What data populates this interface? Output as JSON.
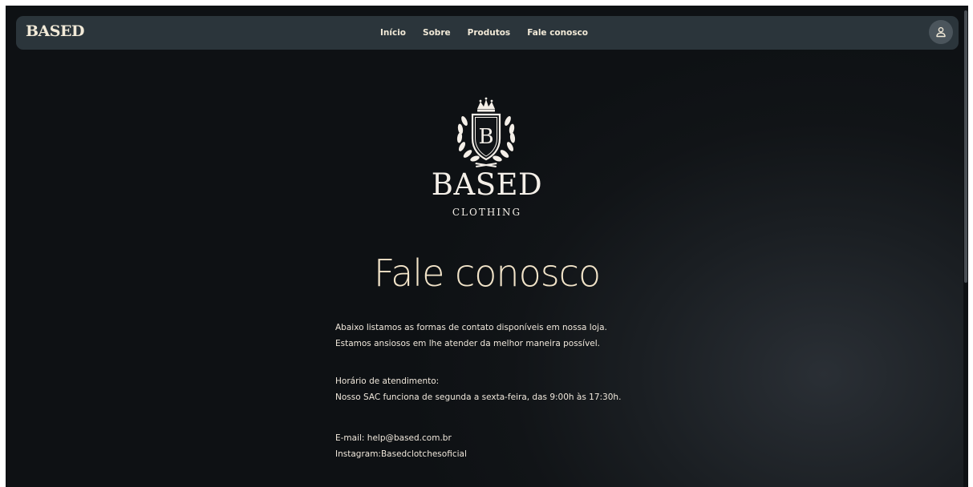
{
  "navbar": {
    "brand": "BASED",
    "links": [
      "Início",
      "Sobre",
      "Produtos",
      "Fale conosco"
    ],
    "user_icon": "user-icon"
  },
  "logo": {
    "monogram": "B",
    "name": "BASED",
    "subtitle": "CLOTHING",
    "icons": [
      "crown-icon",
      "laurel-wreath-icon",
      "shield-icon"
    ]
  },
  "page": {
    "title": "Fale conosco",
    "intro_line1": "Abaixo listamos as formas de contato disponíveis em nossa loja.",
    "intro_line2": "Estamos ansiosos em lhe atender da melhor maneira possível.",
    "hours_label": "Horário de atendimento:",
    "hours_text": "Nosso SAC funciona de segunda a sexta-feira, das 9:00h às 17:30h.",
    "email": "E-mail: help@based.com.br",
    "instagram": "Instagram:Basedclotchesoficial"
  },
  "colors": {
    "background": "#111417",
    "navbar": "#2b353b",
    "title": "#f2e4c9",
    "text": "#f0e8dc"
  }
}
